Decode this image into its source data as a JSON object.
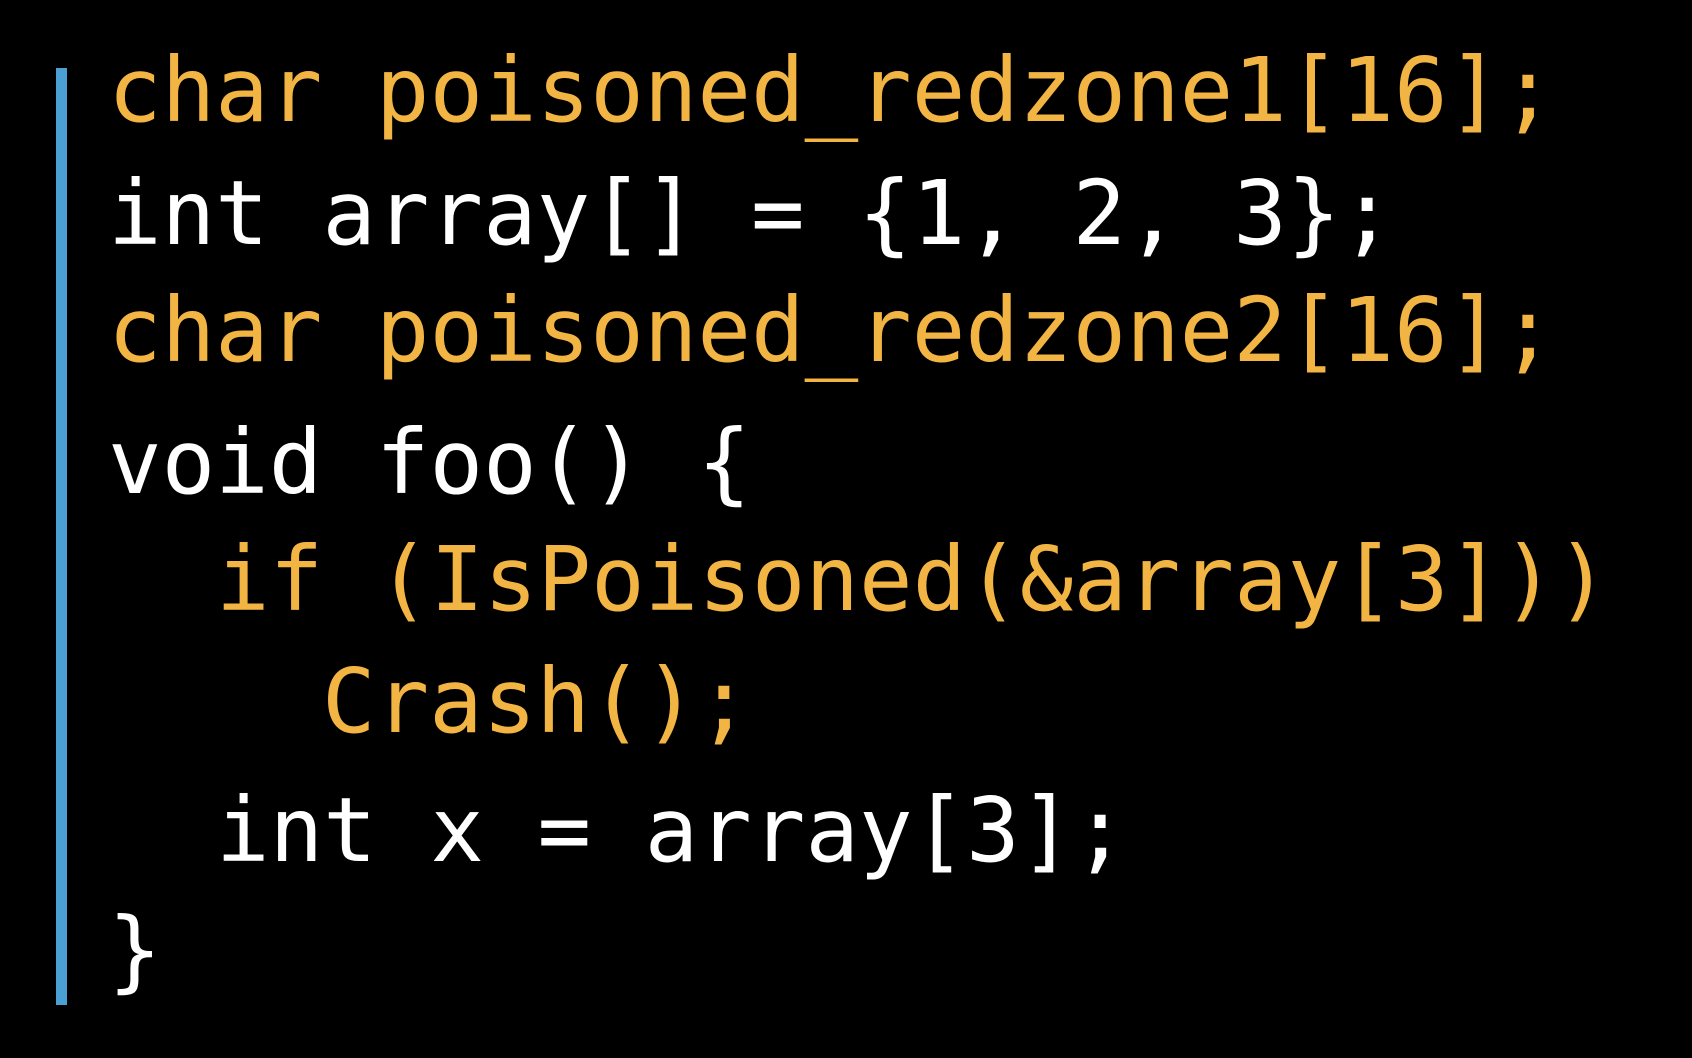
{
  "code": {
    "colors": {
      "highlight": "#f2b544",
      "plain": "#ffffff",
      "accent_bar": "#4a9fd3",
      "background": "#000000"
    },
    "lines": [
      {
        "text": "char poisoned_redzone1[16];",
        "style": "highlight"
      },
      {
        "text": "int array[] = {1, 2, 3};",
        "style": "plain"
      },
      {
        "text": "char poisoned_redzone2[16];",
        "style": "highlight"
      },
      {
        "text": "void foo() {",
        "style": "plain"
      },
      {
        "text": "if (IsPoisoned(&array[3]))",
        "style": "highlight"
      },
      {
        "text": "Crash();",
        "style": "highlight"
      },
      {
        "text": "int x = array[3];",
        "style": "plain"
      },
      {
        "text": "}",
        "style": "plain"
      }
    ]
  }
}
